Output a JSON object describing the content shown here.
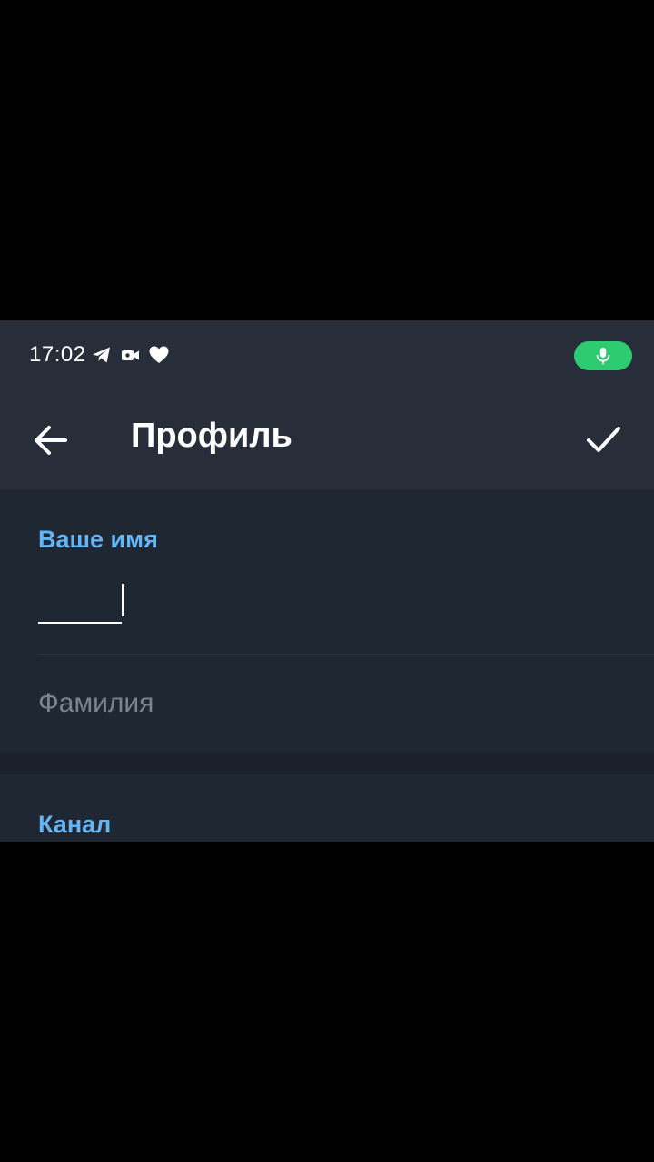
{
  "status_bar": {
    "time": "17:02",
    "icons": [
      "telegram-icon",
      "video-camera-icon",
      "heart-icon"
    ],
    "mic_indicator": "microphone-icon",
    "mic_color": "#2ecc71"
  },
  "app_bar": {
    "back_icon": "arrow-left-icon",
    "title": "Профиль",
    "confirm_icon": "checkmark-icon"
  },
  "form": {
    "name_section_label": "Ваше имя",
    "first_name_value": "",
    "last_name_placeholder": "Фамилия",
    "channel_section_label": "Канал"
  },
  "colors": {
    "accent": "#64b5f6",
    "background": "#1f2732",
    "header": "#272e3a"
  }
}
